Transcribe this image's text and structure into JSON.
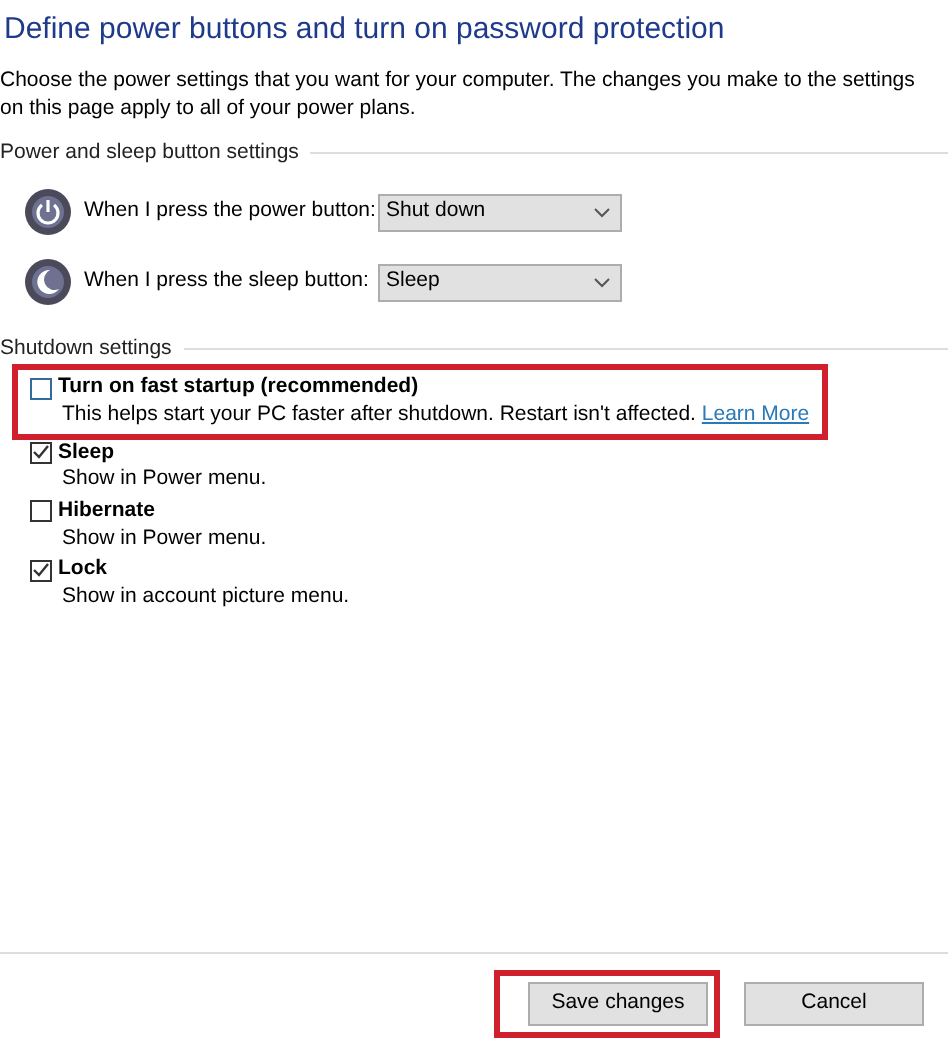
{
  "title": "Define power buttons and turn on password protection",
  "description": "Choose the power settings that you want for your computer. The changes you make to the settings on this page apply to all of your power plans.",
  "button_settings": {
    "heading": "Power and sleep button settings",
    "rows": [
      {
        "kind": "power",
        "label": "When I press the power button:",
        "value": "Shut down"
      },
      {
        "kind": "sleep",
        "label": "When I press the sleep button:",
        "value": "Sleep"
      }
    ]
  },
  "shutdown_settings": {
    "heading": "Shutdown settings",
    "options": [
      {
        "label": "Turn on fast startup (recommended)",
        "description": "This helps start your PC faster after shutdown. Restart isn't affected.",
        "link": "Learn More",
        "checked": false,
        "highlighted": true
      },
      {
        "label": "Sleep",
        "description": "Show in Power menu.",
        "checked": true,
        "highlighted": false
      },
      {
        "label": "Hibernate",
        "description": "Show in Power menu.",
        "checked": false,
        "highlighted": false
      },
      {
        "label": "Lock",
        "description": "Show in account picture menu.",
        "checked": true,
        "highlighted": false
      }
    ]
  },
  "buttons": [
    {
      "label": "Save changes",
      "highlighted": true
    },
    {
      "label": "Cancel",
      "highlighted": false
    }
  ]
}
